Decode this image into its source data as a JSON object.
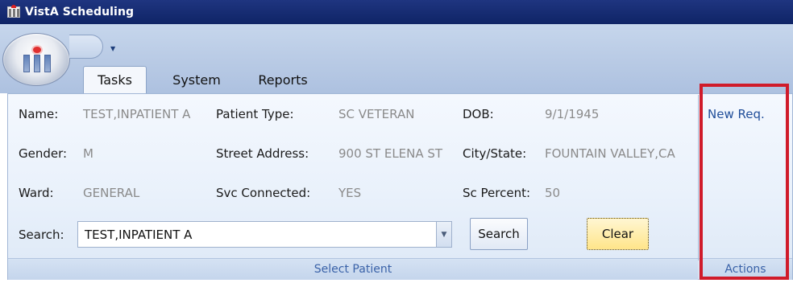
{
  "window": {
    "title": "VistA Scheduling"
  },
  "ribbon": {
    "tabs": [
      {
        "label": "Tasks",
        "selected": true
      },
      {
        "label": "System",
        "selected": false
      },
      {
        "label": "Reports",
        "selected": false
      }
    ]
  },
  "patient": {
    "name_label": "Name:",
    "name_value": "TEST,INPATIENT A",
    "patient_type_label": "Patient Type:",
    "patient_type_value": "SC VETERAN",
    "dob_label": "DOB:",
    "dob_value": "9/1/1945",
    "gender_label": "Gender:",
    "gender_value": "M",
    "street_label": "Street Address:",
    "street_value": "900 ST ELENA ST",
    "city_label": "City/State:",
    "city_value": "FOUNTAIN VALLEY,CA",
    "ward_label": "Ward:",
    "ward_value": "GENERAL",
    "svc_label": "Svc Connected:",
    "svc_value": "YES",
    "sc_percent_label": "Sc Percent:",
    "sc_percent_value": "50"
  },
  "search": {
    "label": "Search:",
    "value": "TEST,INPATIENT A",
    "search_button": "Search",
    "clear_button": "Clear"
  },
  "groups": {
    "select_patient": "Select Patient",
    "actions": "Actions"
  },
  "actions": {
    "new_req": "New Req."
  },
  "colors": {
    "titlebar": "#1f3580",
    "highlight": "#d01b2a",
    "link": "#1f4d99"
  }
}
